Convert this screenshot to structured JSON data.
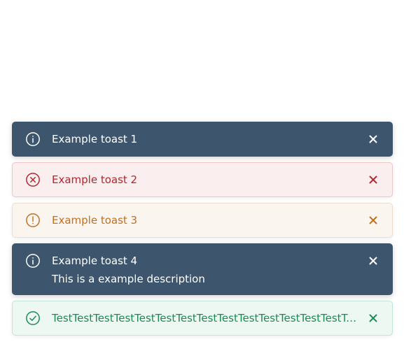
{
  "toasts": [
    {
      "variant": "info",
      "icon": "info-icon",
      "title": "Example toast 1",
      "close_icon": "close-icon"
    },
    {
      "variant": "error",
      "icon": "error-circle-icon",
      "title": "Example toast 2",
      "close_icon": "close-icon"
    },
    {
      "variant": "warning",
      "icon": "warning-circle-icon",
      "title": "Example toast 3",
      "close_icon": "close-icon"
    },
    {
      "variant": "info",
      "icon": "info-icon",
      "title": "Example toast 4",
      "description": "This is a example description",
      "close_icon": "close-icon"
    },
    {
      "variant": "success",
      "icon": "check-circle-icon",
      "title": "TestTestTestTestTestTestTestTestTestTestTestTestTestTestTestTestTestTestTestTest",
      "close_icon": "close-icon"
    }
  ],
  "colors": {
    "info_bg": "#3d566d",
    "error_text": "#b3262d",
    "error_bg": "#fbeeee",
    "warning_text": "#c2701d",
    "warning_bg": "#fbf5f0",
    "success_text": "#1d8a55",
    "success_bg": "#edf8f3"
  }
}
